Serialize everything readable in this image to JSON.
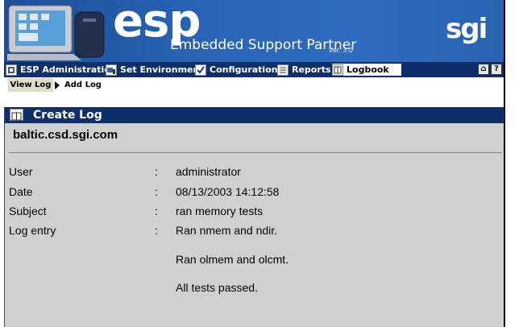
{
  "header": {
    "logo": "esp",
    "subtitle": "Embedded Support Partner",
    "version": "ver. 3.0",
    "brand": "sgi"
  },
  "menu": {
    "items": [
      {
        "label": "ESP Administration",
        "icon": "admin-icon"
      },
      {
        "label": "Set Environment",
        "icon": "environment-icon"
      },
      {
        "label": "Configuration",
        "icon": "checkmark-icon"
      },
      {
        "label": "Reports",
        "icon": "report-icon"
      },
      {
        "label": "Logbook",
        "icon": "logbook-icon",
        "active": true
      }
    ],
    "home_label": "⌂",
    "help_label": "?"
  },
  "subnav": {
    "view_log": "View Log",
    "add_log": "Add Log"
  },
  "panel": {
    "title": "Create Log",
    "hostname": "baltic.csd.sgi.com",
    "fields": [
      {
        "label": "User",
        "value": "administrator"
      },
      {
        "label": "Date",
        "value": "08/13/2003 14:12:58"
      },
      {
        "label": "Subject",
        "value": "ran memory tests"
      },
      {
        "label": "Log entry",
        "value": "Ran nmem and ndir."
      }
    ],
    "log_extra": [
      "Ran olmem and olcmt.",
      "All tests passed."
    ]
  },
  "colors": {
    "banner": "#2a66b8",
    "menubar": "#0f2f6a",
    "panel_bg": "#d0d0d0"
  }
}
